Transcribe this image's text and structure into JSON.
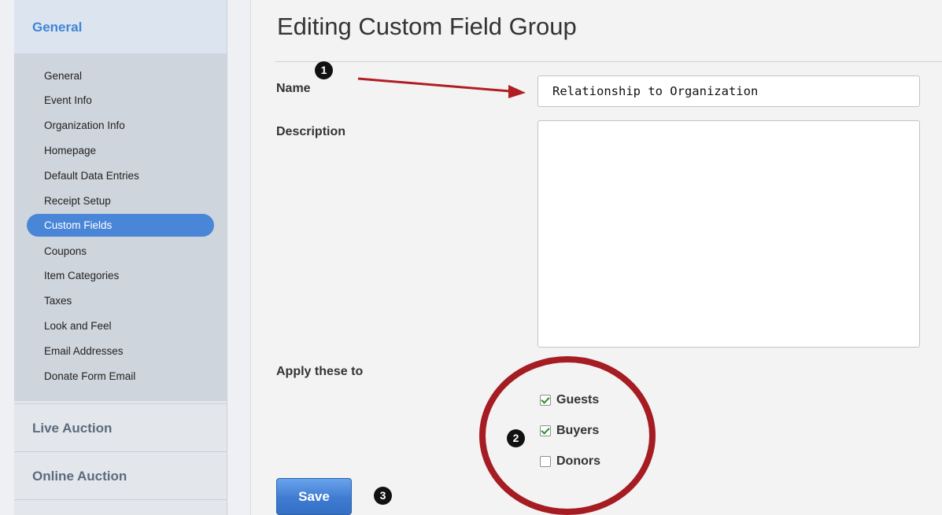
{
  "sidebar": {
    "active_section": "General",
    "items": [
      {
        "label": "General"
      },
      {
        "label": "Event Info"
      },
      {
        "label": "Organization Info"
      },
      {
        "label": "Homepage"
      },
      {
        "label": "Default Data Entries"
      },
      {
        "label": "Receipt Setup"
      },
      {
        "label": "Custom Fields",
        "active": true
      },
      {
        "label": "Coupons"
      },
      {
        "label": "Item Categories"
      },
      {
        "label": "Taxes"
      },
      {
        "label": "Look and Feel"
      },
      {
        "label": "Email Addresses"
      },
      {
        "label": "Donate Form Email"
      }
    ],
    "sections": [
      "Live Auction",
      "Online Auction"
    ]
  },
  "main": {
    "title": "Editing Custom Field Group",
    "name_label": "Name",
    "name_value": "Relationship to Organization",
    "description_label": "Description",
    "description_value": "",
    "apply_label": "Apply these to",
    "apply_options": [
      {
        "label": "Guests",
        "checked": true
      },
      {
        "label": "Buyers",
        "checked": true
      },
      {
        "label": "Donors",
        "checked": false
      }
    ],
    "save_label": "Save"
  },
  "annotations": {
    "markers": [
      "1",
      "2",
      "3"
    ],
    "color": "#b01e23"
  },
  "colors": {
    "accent": "#4a86d8",
    "section_active": "#3f86d6",
    "annotation": "#b01e23"
  }
}
